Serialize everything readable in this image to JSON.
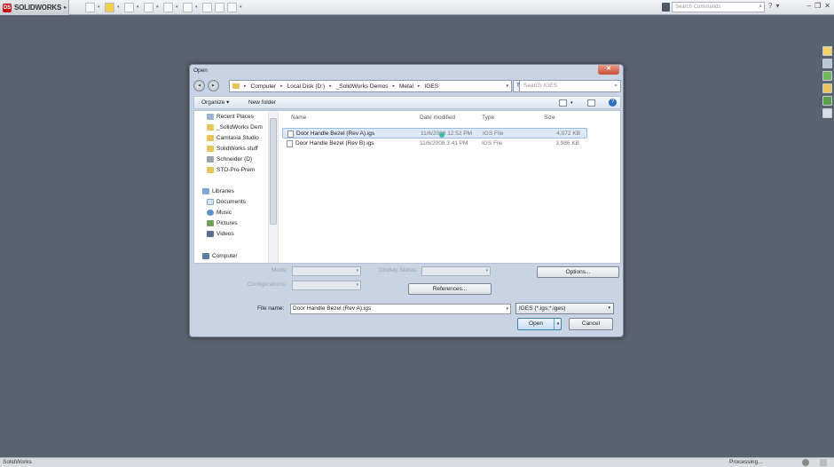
{
  "app": {
    "logo_text": "SOLIDWORKS",
    "command_search_placeholder": "Search Commands"
  },
  "dialog": {
    "title": "Open",
    "breadcrumb": [
      "Computer",
      "Local Disk (D:)",
      "_SolidWorks Demos",
      "Metal",
      "IGES"
    ],
    "search_placeholder": "Search IGES",
    "organize_label": "Organize",
    "new_folder_label": "New folder",
    "nav_items": [
      {
        "label": "Recent Places",
        "icon": "recent-places-icon"
      },
      {
        "label": "_SolidWorks Dem",
        "icon": "folder-icon"
      },
      {
        "label": "Camtasia Studio",
        "icon": "folder-icon"
      },
      {
        "label": "SolidWorks stuff",
        "icon": "folder-icon"
      },
      {
        "label": "Schneider (D)",
        "icon": "drive-icon"
      },
      {
        "label": "STO-Pro-Prem",
        "icon": "folder-icon"
      },
      {
        "label": "Libraries",
        "icon": "library-icon"
      },
      {
        "label": "Documents",
        "icon": "documents-icon"
      },
      {
        "label": "Music",
        "icon": "music-icon"
      },
      {
        "label": "Pictures",
        "icon": "pictures-icon"
      },
      {
        "label": "Videos",
        "icon": "videos-icon"
      },
      {
        "label": "Computer",
        "icon": "computer-icon"
      }
    ],
    "columns": {
      "name": "Name",
      "date": "Date modified",
      "type": "Type",
      "size": "Size"
    },
    "files": [
      {
        "name": "Door Handle Bezel (Rev A).igs",
        "date": "11/6/2008 12:52 PM",
        "type": "IGS File",
        "size": "4,072 KB",
        "selected": true
      },
      {
        "name": "Door Handle Bezel (Rev B).igs",
        "date": "11/6/2008 3:41 PM",
        "type": "IGS File",
        "size": "3,986 KB",
        "selected": false
      }
    ],
    "mode_label": "Mode:",
    "configurations_label": "Configurations:",
    "display_states_label": "Display States:",
    "options_label": "Options...",
    "references_label": "References...",
    "file_name_label": "File name:",
    "file_name_value": "Door Handle Bezel (Rev A).igs",
    "file_type_value": "IGES (*.igs;*.iges)",
    "open_label": "Open",
    "cancel_label": "Cancel"
  },
  "status": {
    "left": "SolidWorks",
    "right": "Processing..."
  }
}
